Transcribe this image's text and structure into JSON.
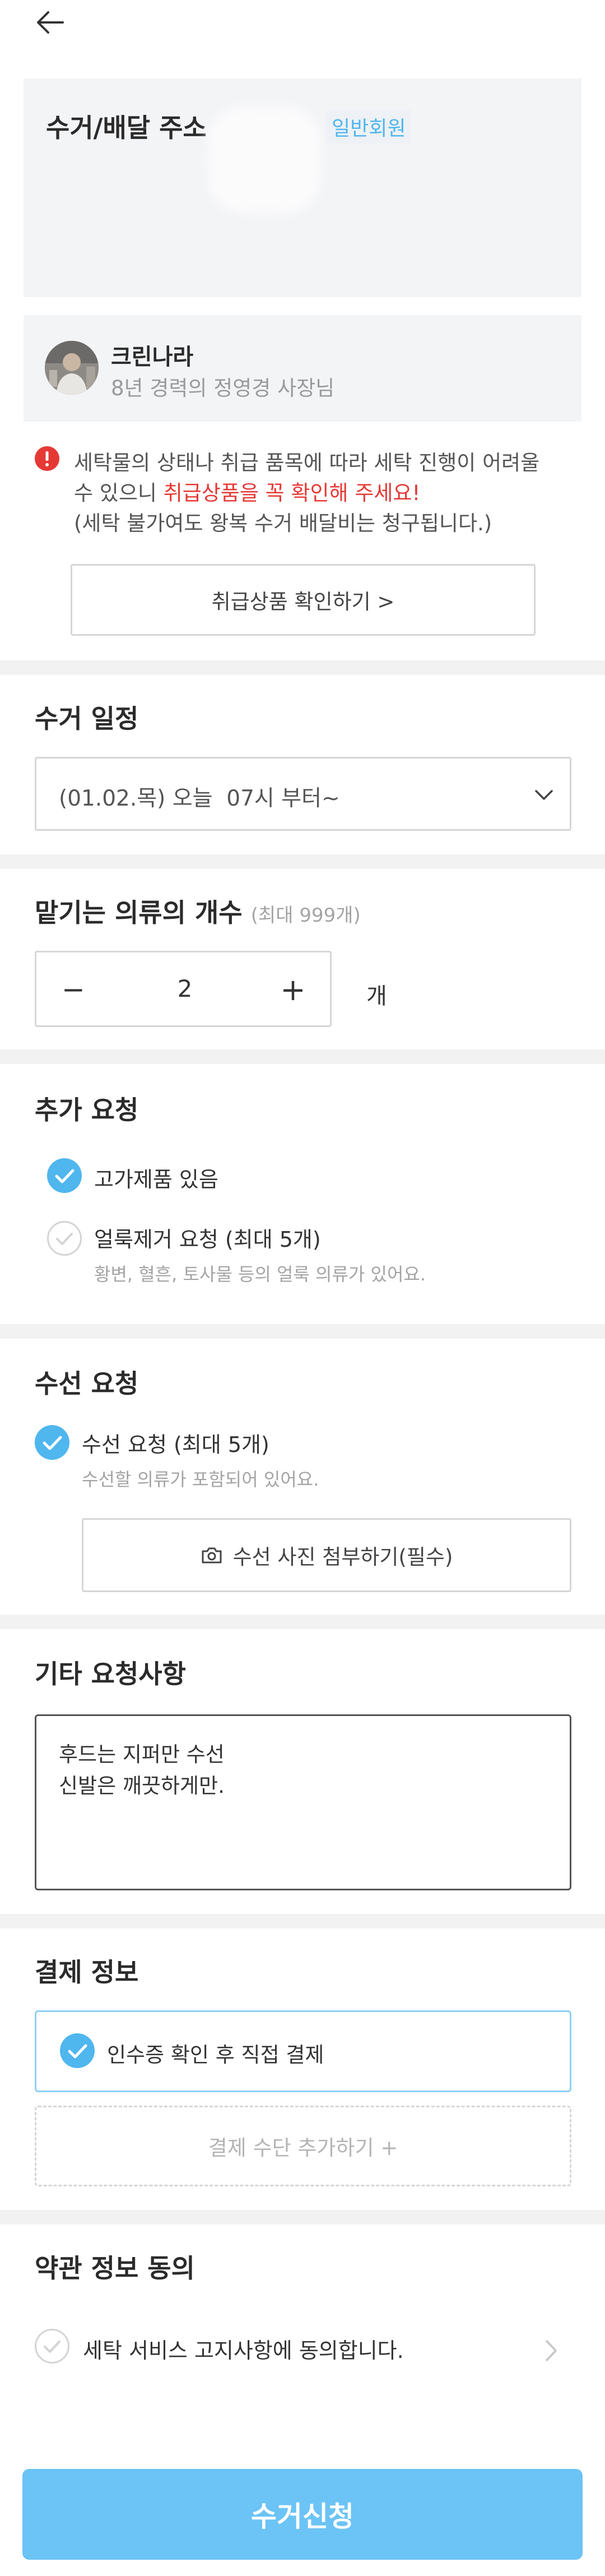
{
  "header": {
    "back_icon": "arrow-left-icon"
  },
  "address": {
    "title": "수거/배달 주소",
    "member_badge": "일반회원"
  },
  "shop": {
    "name": "크린나라",
    "subtitle": "8년 경력의 정영경 사장님"
  },
  "notice": {
    "icon": "alert-icon",
    "line1": "세탁물의 상태나 취급 품목에 따라 세탁 진행이 어려울",
    "line2_prefix": "수 있으니 ",
    "line2_highlight": "취급상품을 꼭 확인해 주세요!",
    "line3": "(세탁 불가여도 왕복 수거 배달비는 청구됩니다.)",
    "button": "취급상품 확인하기 >",
    "accent_color": "#e53935"
  },
  "schedule": {
    "title": "수거 일정",
    "selected": "(01.02.목) 오늘  07시 부터~"
  },
  "count": {
    "title": "맡기는 의류의 개수",
    "hint": "(최대 999개)",
    "minus": "−",
    "value": "2",
    "plus": "+",
    "unit": "개"
  },
  "extra": {
    "title": "추가 요청",
    "option1": "고가제품 있음",
    "option1_checked": true,
    "option2": "얼룩제거 요청 (최대 5개)",
    "option2_checked": false,
    "option2_sub": "황변, 혈흔, 토사물 등의 얼룩 의류가 있어요."
  },
  "repair": {
    "title": "수선 요청",
    "option": "수선 요청 (최대 5개)",
    "option_checked": true,
    "option_sub": "수선할 의류가 포함되어 있어요.",
    "photo_button": "수선 사진 첨부하기(필수)"
  },
  "memo": {
    "title": "기타 요청사항",
    "line1": "후드는 지퍼만 수선",
    "line2": "신발은 깨끗하게만."
  },
  "payment": {
    "title": "결제 정보",
    "method": "인수증 확인 후 직접 결제",
    "add": "결제 수단 추가하기 +"
  },
  "terms": {
    "title": "약관 정보 동의",
    "item": "세탁 서비스 고지사항에 동의합니다."
  },
  "submit": {
    "label": "수거신청",
    "color": "#6cc3f5"
  }
}
